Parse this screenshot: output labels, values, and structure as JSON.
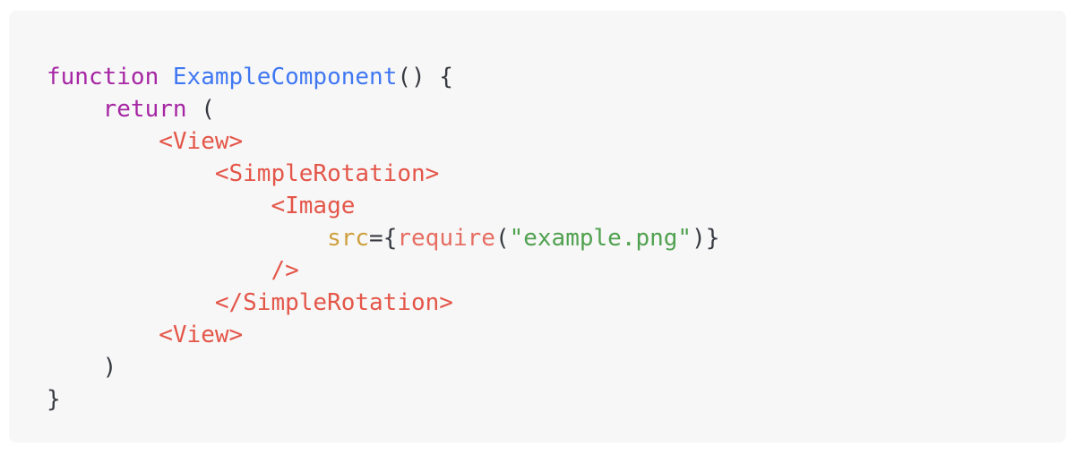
{
  "code": {
    "l1": {
      "kw": "function",
      "fn": "ExampleComponent",
      "rest": "() {"
    },
    "l2": {
      "kw": "return",
      "rest": " ("
    },
    "l3": {
      "tag": "<View>"
    },
    "l4": {
      "tag": "<SimpleRotation>"
    },
    "l5": {
      "tag": "<Image"
    },
    "l6": {
      "attr": "src",
      "eq": "={",
      "call": "require",
      "open": "(",
      "str": "\"example.png\"",
      "close": ")}"
    },
    "l7": {
      "tag": "/>"
    },
    "l8": {
      "tag": "</SimpleRotation>"
    },
    "l9": {
      "tag": "<View>"
    },
    "l10": {
      "rest": ")"
    },
    "l11": {
      "rest": "}"
    }
  },
  "colors": {
    "keyword": "#a626a4",
    "function": "#4078f2",
    "tag": "#e45649",
    "attribute": "#c18401",
    "string": "#50a14f",
    "text": "#383a42",
    "background": "#f7f7f7"
  }
}
